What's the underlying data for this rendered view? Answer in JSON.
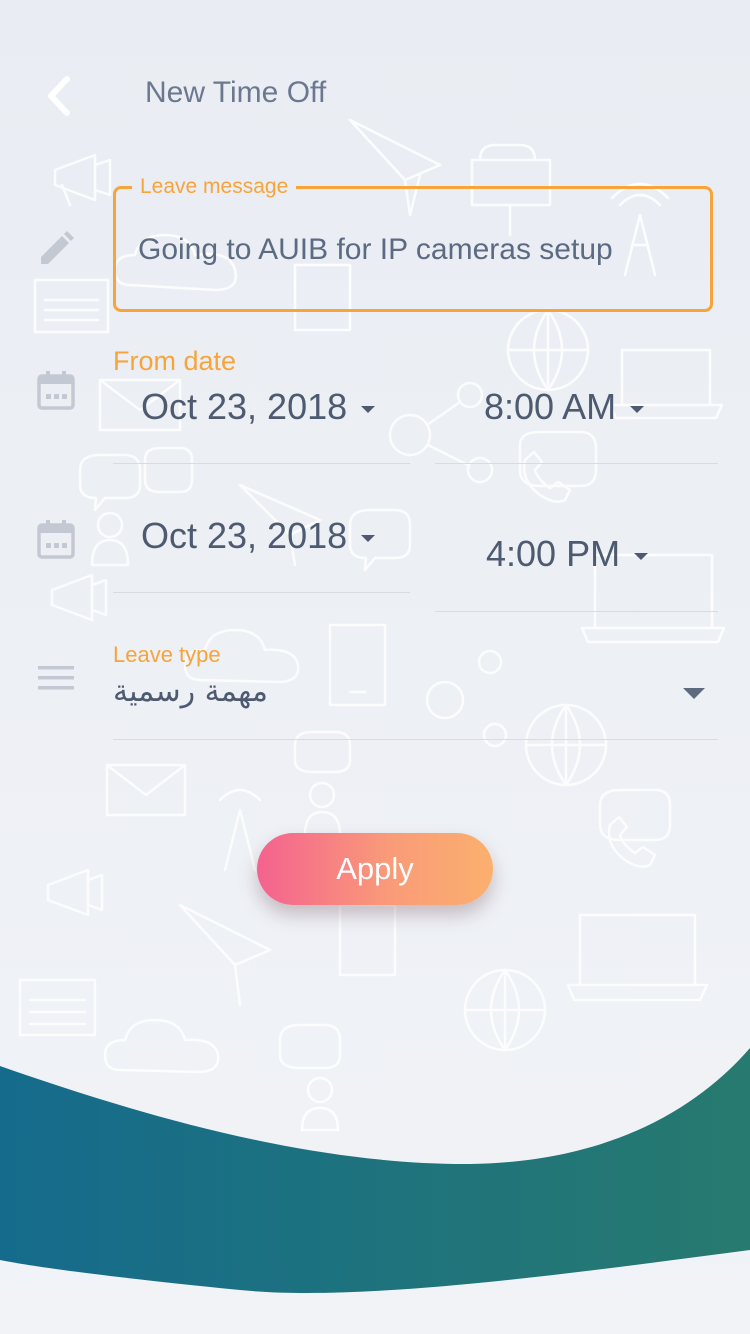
{
  "header": {
    "title": "New Time Off"
  },
  "message": {
    "legend": "Leave message",
    "value": "Going to AUIB for IP cameras setup"
  },
  "from": {
    "label": "From date",
    "date": "Oct 23, 2018",
    "time": "8:00 AM"
  },
  "to": {
    "date": "Oct 23, 2018",
    "time": "4:00 PM"
  },
  "leave_type": {
    "label": "Leave type",
    "value": "مهمة رسمية"
  },
  "actions": {
    "apply_label": "Apply"
  },
  "colors": {
    "accent": "#f7a43b",
    "button_gradient_start": "#f4628f",
    "button_gradient_end": "#fbb06e",
    "wave_start": "#156b8c",
    "wave_end": "#277a6f"
  },
  "icons": {
    "back": "chevron-left-icon",
    "message": "pencil-icon",
    "from_date": "calendar-icon",
    "to_date": "calendar-icon",
    "leave_type": "menu-lines-icon",
    "type_dropdown": "triangle-down-icon"
  }
}
